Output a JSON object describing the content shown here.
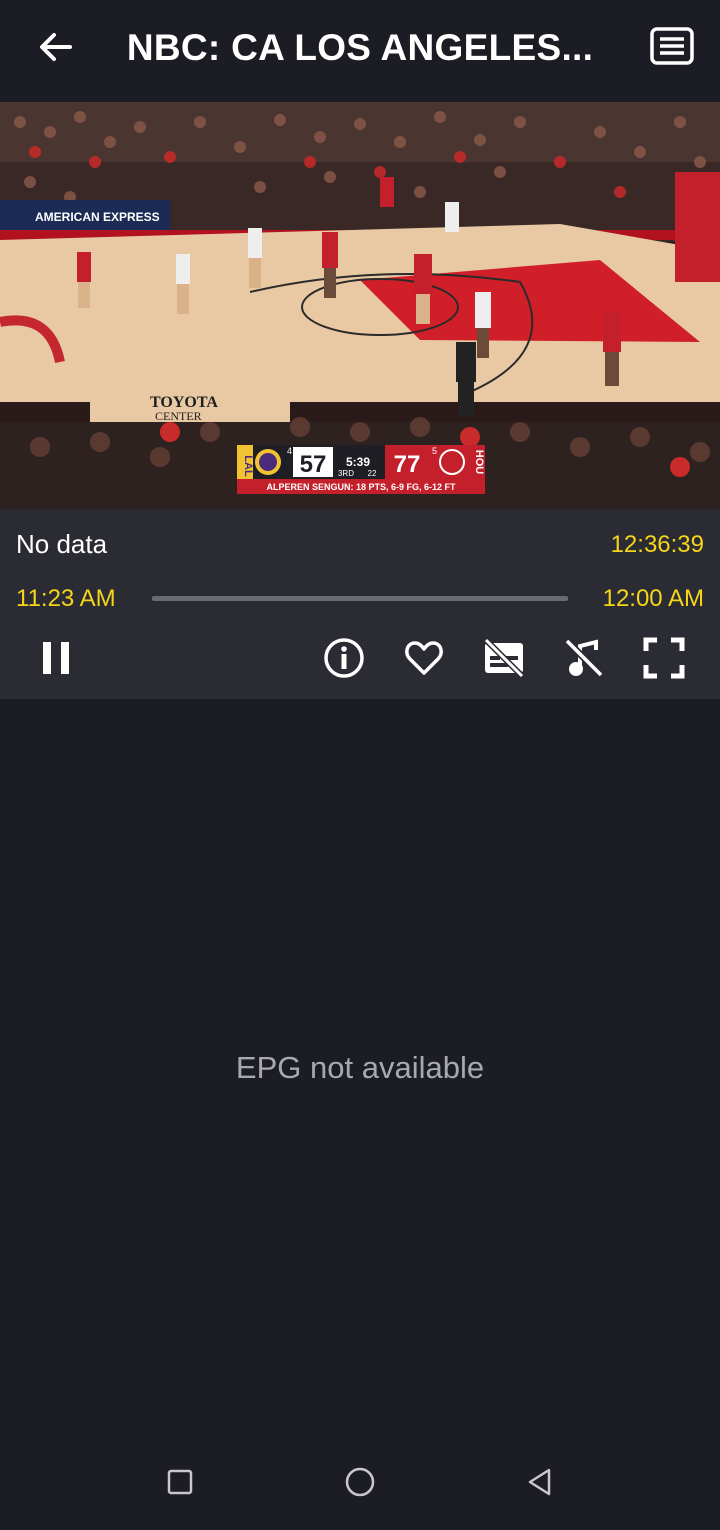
{
  "header": {
    "title": "NBC: CA LOS ANGELES...",
    "back_icon": "arrow-left-icon",
    "menu_icon": "list-icon"
  },
  "video": {
    "banner_text": "AMERICAN EXPRESS",
    "arena_text_1": "TOYOTA",
    "arena_text_2": "CENTER",
    "scorebug": {
      "team_a": "LAL",
      "team_a_score": "57",
      "team_a_fouls": "4",
      "game_clock": "5:39",
      "period": "3RD",
      "shot_clock": "22",
      "team_b": "HOU",
      "team_b_score": "77",
      "team_b_fouls": "5",
      "stat_line": "ALPEREN SENGUN:   18 PTS,   6-9 FG,   6-12 FT"
    }
  },
  "player": {
    "program": "No data",
    "clock": "12:36:39",
    "start_time": "11:23 AM",
    "end_time": "12:00 AM",
    "progress_fraction": 0,
    "controls": [
      "pause-icon",
      "info-icon",
      "heart-icon",
      "subtitles-off-icon",
      "audio-off-icon",
      "fullscreen-icon"
    ]
  },
  "epg": {
    "message": "EPG not available"
  },
  "system_nav": [
    "recents-square-icon",
    "home-circle-icon",
    "back-triangle-icon"
  ],
  "colors": {
    "accent": "#f4d51a",
    "background": "#1b1c24",
    "panel": "#2b2c33"
  }
}
